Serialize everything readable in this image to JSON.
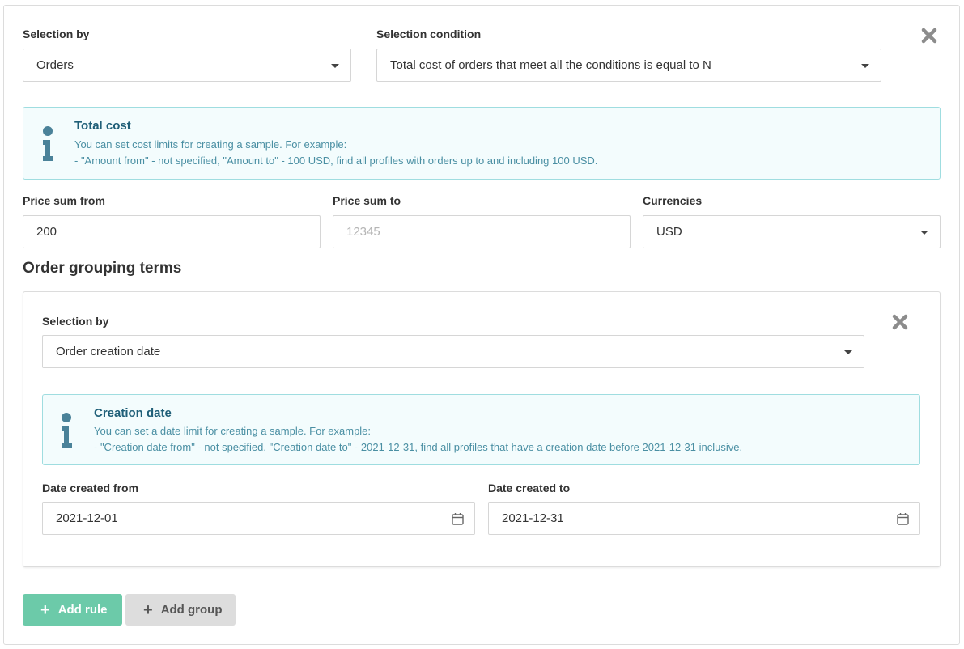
{
  "rule": {
    "selection_by_label": "Selection by",
    "selection_by_value": "Orders",
    "selection_condition_label": "Selection condition",
    "selection_condition_value": "Total cost of orders that meet all the conditions is equal to N"
  },
  "info_cost": {
    "title": "Total cost",
    "line1": "You can set cost limits for creating a sample. For example:",
    "line2": "- \"Amount from\" - not specified, \"Amount to\" - 100 USD, find all profiles with orders up to and including 100 USD."
  },
  "price": {
    "from_label": "Price sum from",
    "from_value": "200",
    "to_label": "Price sum to",
    "to_placeholder": "12345",
    "currency_label": "Currencies",
    "currency_value": "USD"
  },
  "grouping": {
    "title": "Order grouping terms",
    "selection_by_label": "Selection by",
    "selection_by_value": "Order creation date",
    "info": {
      "title": "Creation date",
      "line1": "You can set a date limit for creating a sample. For example:",
      "line2": "- \"Creation date from\" - not specified, \"Creation date to\" - 2021-12-31, find all profiles that have a creation date before 2021-12-31 inclusive."
    },
    "date_from_label": "Date created from",
    "date_from_value": "2021-12-01",
    "date_to_label": "Date created to",
    "date_to_value": "2021-12-31"
  },
  "buttons": {
    "add_rule": "Add rule",
    "add_group": "Add group"
  },
  "colors": {
    "accent_green": "#6ccaa9",
    "info_bg": "#f3fcfd",
    "info_border": "#9fdde0",
    "info_title": "#1f5f78",
    "info_text": "#4a8fa3",
    "info_icon": "#4a8299"
  }
}
